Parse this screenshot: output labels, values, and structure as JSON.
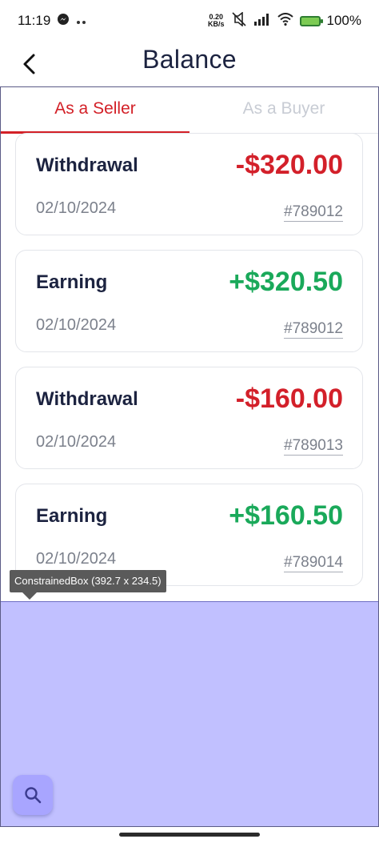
{
  "status_bar": {
    "time": "11:19",
    "net_speed_value": "0.20",
    "net_speed_unit": "KB/s",
    "battery": "100%"
  },
  "appbar": {
    "title": "Balance",
    "back_icon": "chevron-left-icon"
  },
  "tabs": [
    {
      "label": "As a Seller",
      "active": true
    },
    {
      "label": "As a Buyer",
      "active": false
    }
  ],
  "transactions": [
    {
      "type": "Withdrawal",
      "amount": "-$320.00",
      "date": "02/10/2024",
      "ref": "#789012",
      "sign": "negative"
    },
    {
      "type": "Earning",
      "amount": "+$320.50",
      "date": "02/10/2024",
      "ref": "#789012",
      "sign": "positive"
    },
    {
      "type": "Withdrawal",
      "amount": "-$160.00",
      "date": "02/10/2024",
      "ref": "#789013",
      "sign": "negative"
    },
    {
      "type": "Earning",
      "amount": "+$160.50",
      "date": "02/10/2024",
      "ref": "#789014",
      "sign": "positive"
    }
  ],
  "debug_tooltip": "ConstrainedBox (392.7 x 234.5)",
  "fab_icon": "search-icon",
  "colors": {
    "accent_red": "#d32027",
    "positive_green": "#1aa95a",
    "overlay": "#c1c0ff"
  }
}
